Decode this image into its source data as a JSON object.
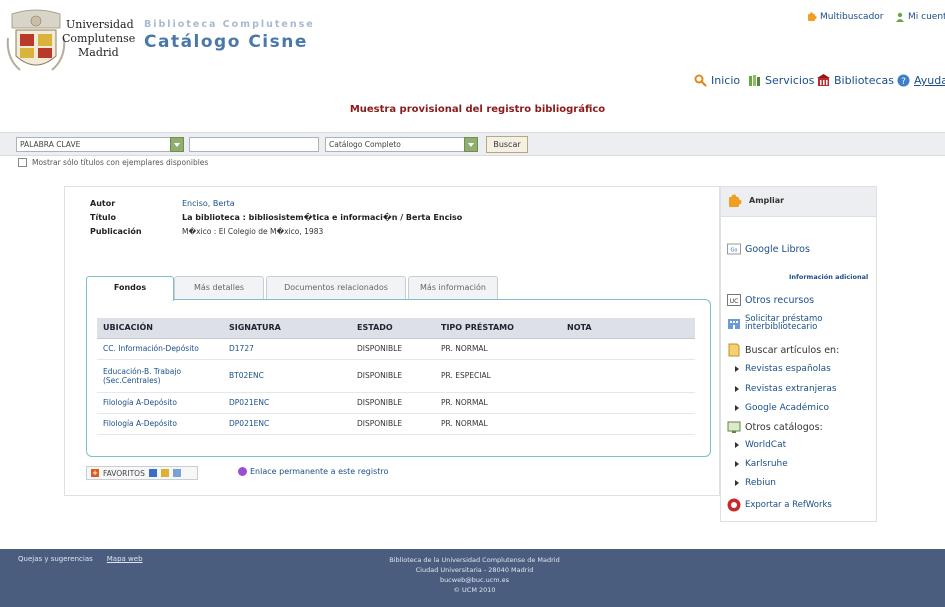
{
  "header": {
    "university_lines": [
      "Universidad",
      "Complutense",
      "Madrid"
    ],
    "library_title": "Biblioteca Complutense",
    "catalog_title": "Catálogo Cisne"
  },
  "top_links": {
    "multibuscador": "Multibuscador",
    "my_account": "Mi cuenta"
  },
  "nav": {
    "home": "Inicio",
    "services": "Servicios",
    "libraries": "Bibliotecas",
    "help": "Ayuda"
  },
  "record_heading": "Muestra provisional del registro bibliográfico",
  "search": {
    "field_type": "PALABRA CLAVE",
    "query_value": "",
    "catalog_scope": "Catálogo Completo",
    "submit_label": "Buscar",
    "available_only_label": "Mostrar sólo títulos con ejemplares disponibles"
  },
  "record": {
    "author_label": "Autor",
    "author_value": "Enciso, Berta",
    "title_label": "Título",
    "title_value": "La biblioteca : bibliosistem�tica e informaci�n / Berta Enciso",
    "publication_label": "Publicación",
    "publication_value": "M�xico : El Colegio de M�xico, 1983"
  },
  "tabs": [
    "Fondos",
    "Más detalles",
    "Documentos relacionados",
    "Más información"
  ],
  "holdings": {
    "columns": [
      "UBICACIÓN",
      "SIGNATURA",
      "ESTADO",
      "TIPO PRÉSTAMO",
      "NOTA"
    ],
    "rows": [
      {
        "location": "CC. Información-Depósito",
        "call_number": "D1727",
        "status": "DISPONIBLE",
        "loan_type": "PR. NORMAL",
        "note": ""
      },
      {
        "location": "Educación-B. Trabajo (Sec.Centrales)",
        "call_number": "BT02ENC",
        "status": "DISPONIBLE",
        "loan_type": "PR. ESPECIAL",
        "note": ""
      },
      {
        "location": "Filología A-Depósito",
        "call_number": "DP021ENC",
        "status": "DISPONIBLE",
        "loan_type": "PR. NORMAL",
        "note": ""
      },
      {
        "location": "Filología A-Depósito",
        "call_number": "DP021ENC",
        "status": "DISPONIBLE",
        "loan_type": "PR. NORMAL",
        "note": ""
      }
    ]
  },
  "share": {
    "favorites_label": "FAVORITOS",
    "permalink_label": "Enlace permanente a este registro"
  },
  "sidebar": {
    "expand_label": "Ampliar",
    "google_books": "Google Libros",
    "additional_info": "Información adicional",
    "other_resources": "Otros recursos",
    "interlibrary_loan": "Solicitar préstamo interbibliotecario",
    "search_articles_in": "Buscar artículos en:",
    "article_sources": [
      "Revistas españolas",
      "Revistas extranjeras",
      "Google Académico"
    ],
    "other_catalogs": "Otros catálogos:",
    "catalogs": [
      "WorldCat",
      "Karlsruhe",
      "Rebiun"
    ],
    "export_refworks": "Exportar a RefWorks"
  },
  "footer": {
    "links": [
      "Quejas y sugerencias",
      "Mapa web"
    ],
    "info_lines": [
      "Biblioteca de la Universidad Complutense de Madrid",
      "Ciudad Universitaria - 28040 Madrid",
      "bucweb@buc.ucm.es",
      "© UCM 2010"
    ]
  }
}
